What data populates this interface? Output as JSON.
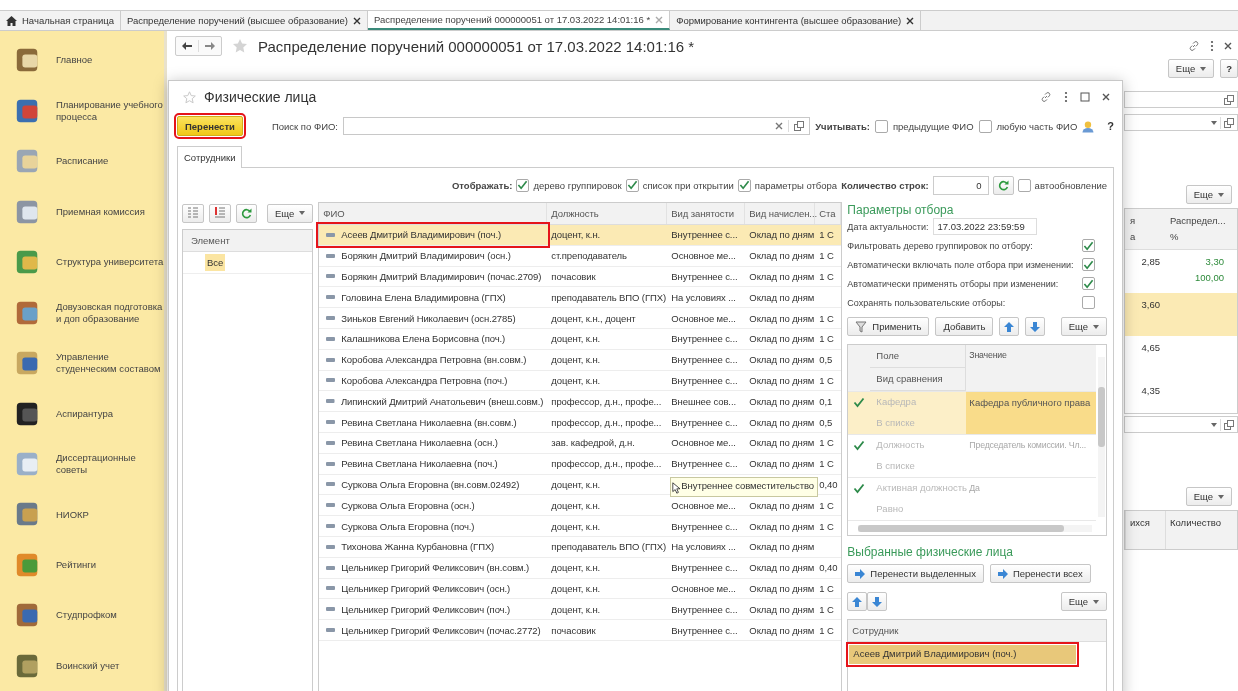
{
  "tabs": [
    {
      "label": "Начальная страница",
      "kind": "home",
      "selected": false,
      "closable": false
    },
    {
      "label": "Распределение поручений (высшее образование)",
      "kind": "document",
      "selected": false,
      "closable": true
    },
    {
      "label": "Распределение поручений 000000051 от 17.03.2022 14:01:16 *",
      "kind": "document",
      "selected": true,
      "closable": true
    },
    {
      "label": "Формирование контингента (высшее образование)",
      "kind": "document",
      "selected": false,
      "closable": true
    }
  ],
  "sidebar": {
    "items": [
      {
        "label": "Главное"
      },
      {
        "label": "Планирование учебного процесса"
      },
      {
        "label": "Расписание"
      },
      {
        "label": "Приемная комиссия"
      },
      {
        "label": "Структура университета"
      },
      {
        "label": "Довузовская подготовка и доп образование"
      },
      {
        "label": "Управление студенческим составом"
      },
      {
        "label": "Аспирантура"
      },
      {
        "label": "Диссертационные советы"
      },
      {
        "label": "НИОКР"
      },
      {
        "label": "Рейтинги"
      },
      {
        "label": "Студпрофком"
      },
      {
        "label": "Воинский учет"
      }
    ]
  },
  "document": {
    "title": "Распределение поручений 000000051 от 17.03.2022 14:01:16 *",
    "more_button": "Еще",
    "help_button": "?",
    "side": {
      "fields": [
        {
          "kind": "text"
        },
        {
          "kind": "dropdown"
        }
      ],
      "more_button": "Еще",
      "table": {
        "columns": [
          [
            "я",
            "а"
          ],
          [
            "Распредел...",
            "%"
          ]
        ],
        "rows": [
          {
            "selected": false,
            "values": [
              [
                "2,85"
              ],
              [
                "3,30",
                "100,00"
              ]
            ]
          },
          {
            "selected": true,
            "values": [
              [
                "3,60"
              ]
            ]
          },
          {
            "selected": false,
            "values": [
              [
                "4,65"
              ]
            ]
          },
          {
            "selected": false,
            "values": [
              [
                "4,35"
              ]
            ]
          }
        ]
      },
      "field": {
        "kind": "dropdown"
      },
      "more_button_2": "Еще",
      "table_2": {
        "columns": [
          "ихся",
          "Количество"
        ]
      }
    }
  },
  "modal": {
    "title": "Физические лица",
    "transfer_button": {
      "label": "Перенести",
      "highlighted": true
    },
    "search": {
      "label": "Поиск по ФИО:"
    },
    "consider": {
      "label": "Учитывать:",
      "options": [
        {
          "label": "предыдущие ФИО",
          "checked": false
        },
        {
          "label": "любую часть ФИО",
          "checked": false
        }
      ]
    },
    "help": "?",
    "tabs": [
      {
        "label": "Сотрудники",
        "selected": true
      }
    ],
    "display": {
      "label": "Отображать:",
      "options": [
        {
          "label": "дерево группировок",
          "checked": true
        },
        {
          "label": "список при открытии",
          "checked": true
        },
        {
          "label": "параметры отбора",
          "checked": true
        }
      ]
    },
    "row_count": {
      "label": "Количество строк:",
      "value": "0"
    },
    "auto_refresh": {
      "label": "автообновление",
      "checked": false
    },
    "tree": {
      "more_button": "Еще",
      "column": "Элемент",
      "items": [
        {
          "label": "Все",
          "selected": true
        }
      ]
    },
    "table": {
      "columns": [
        "ФИО",
        "Должность",
        "Вид занятости",
        "Вид начислен...",
        "Ста"
      ],
      "rows": [
        {
          "fio": "Асеев Дмитрий Владимирович (поч.)",
          "position": "доцент, к.н.",
          "employment": "Внутреннее с...",
          "accrual": "Оклад по дням",
          "rate": "1 С",
          "selected": true,
          "highlighted": true
        },
        {
          "fio": "Борякин Дмитрий Владимирович (осн.)",
          "position": "ст.преподаватель",
          "employment": "Основное ме...",
          "accrual": "Оклад по дням",
          "rate": "1 С",
          "selected": false,
          "highlighted": false
        },
        {
          "fio": "Борякин Дмитрий Владимирович (почас.2709)",
          "position": "почасовик",
          "employment": "Внутреннее с...",
          "accrual": "Оклад по дням",
          "rate": "1 С",
          "selected": false,
          "highlighted": false
        },
        {
          "fio": "Головина Елена Владимировна (ГПХ)",
          "position": "преподаватель ВПО (ГПХ)",
          "employment": "На условиях ...",
          "accrual": "Оклад по дням",
          "selected": false,
          "highlighted": false
        },
        {
          "fio": "Зиньков Евгений Николаевич (осн.2785)",
          "position": "доцент, к.н., доцент",
          "employment": "Основное ме...",
          "accrual": "Оклад по дням",
          "rate": "1 С",
          "selected": false,
          "highlighted": false
        },
        {
          "fio": "Калашникова Елена Борисовна (поч.)",
          "position": "доцент, к.н.",
          "employment": "Внутреннее с...",
          "accrual": "Оклад по дням",
          "rate": "1 С",
          "selected": false,
          "highlighted": false
        },
        {
          "fio": "Коробова Александра Петровна (вн.совм.)",
          "position": "доцент, к.н.",
          "employment": "Внутреннее с...",
          "accrual": "Оклад по дням",
          "rate": "0,5",
          "selected": false,
          "highlighted": false
        },
        {
          "fio": "Коробова Александра Петровна (поч.)",
          "position": "доцент, к.н.",
          "employment": "Внутреннее с...",
          "accrual": "Оклад по дням",
          "rate": "1 С",
          "selected": false,
          "highlighted": false
        },
        {
          "fio": "Липинский Дмитрий Анатольевич (внеш.совм.)",
          "position": "профессор, д.н., профе...",
          "employment": "Внешнее сов...",
          "accrual": "Оклад по дням",
          "rate": "0,1",
          "selected": false,
          "highlighted": false
        },
        {
          "fio": "Ревина Светлана Николаевна (вн.совм.)",
          "position": "профессор, д.н., профе...",
          "employment": "Внутреннее с...",
          "accrual": "Оклад по дням",
          "rate": "0,5",
          "selected": false,
          "highlighted": false
        },
        {
          "fio": "Ревина Светлана Николаевна (осн.)",
          "position": "зав. кафедрой, д.н.",
          "employment": "Основное ме...",
          "accrual": "Оклад по дням",
          "rate": "1 С",
          "selected": false,
          "highlighted": false
        },
        {
          "fio": "Ревина Светлана Николаевна (поч.)",
          "position": "профессор, д.н., профе...",
          "employment": "Внутреннее с...",
          "accrual": "Оклад по дням",
          "rate": "1 С",
          "selected": false,
          "highlighted": false
        },
        {
          "fio": "Суркова Ольга Егоровна (вн.совм.02492)",
          "position": "доцент, к.н.",
          "tooltip": "Внутреннее совместительство",
          "rate": "0,40",
          "selected": false,
          "highlighted": false
        },
        {
          "fio": "Суркова Ольга Егоровна (осн.)",
          "position": "доцент, к.н.",
          "employment": "Основное ме...",
          "accrual": "Оклад по дням",
          "rate": "1 С",
          "selected": false,
          "highlighted": false
        },
        {
          "fio": "Суркова Ольга Егоровна (поч.)",
          "position": "доцент, к.н.",
          "employment": "Внутреннее с...",
          "accrual": "Оклад по дням",
          "rate": "1 С",
          "selected": false,
          "highlighted": false
        },
        {
          "fio": "Тихонова Жанна Курбановна (ГПХ)",
          "position": "преподаватель ВПО (ГПХ)",
          "employment": "На условиях ...",
          "accrual": "Оклад по дням",
          "selected": false,
          "highlighted": false
        },
        {
          "fio": "Цельникер Григорий Феликсович (вн.совм.)",
          "position": "доцент, к.н.",
          "employment": "Внутреннее с...",
          "accrual": "Оклад по дням",
          "rate": "0,40",
          "selected": false,
          "highlighted": false
        },
        {
          "fio": "Цельникер Григорий Феликсович (осн.)",
          "position": "доцент, к.н.",
          "employment": "Основное ме...",
          "accrual": "Оклад по дням",
          "rate": "1 С",
          "selected": false,
          "highlighted": false
        },
        {
          "fio": "Цельникер Григорий Феликсович (поч.)",
          "position": "доцент, к.н.",
          "employment": "Внутреннее с...",
          "accrual": "Оклад по дням",
          "rate": "1 С",
          "selected": false,
          "highlighted": false
        },
        {
          "fio": "Цельникер Григорий Феликсович (почас.2772)",
          "position": "почасовик",
          "employment": "Внутреннее с...",
          "accrual": "Оклад по дням",
          "rate": "1 С",
          "selected": false,
          "highlighted": false
        }
      ]
    },
    "filter": {
      "title": "Параметры отбора",
      "date_label": "Дата актуальности:",
      "date_value": "17.03.2022 23:59:59",
      "settings": [
        {
          "label": "Фильтровать дерево группировок по отбору:",
          "checked": true
        },
        {
          "label": "Автоматически включать поле отбора при изменении:",
          "checked": true
        },
        {
          "label": "Автоматически применять отборы при изменении:",
          "checked": true
        },
        {
          "label": "Сохранять пользовательские отборы:",
          "checked": false
        }
      ],
      "apply_button": "Применить",
      "add_button": "Добавить",
      "more_button": "Еще",
      "columns": [
        "Поле",
        "Вид сравнения",
        "Значение"
      ],
      "rows": [
        {
          "field": "Кафедра",
          "comparison": "В списке",
          "value": "Кафедра публичного права",
          "checked": true,
          "selected": true
        },
        {
          "field": "Должность",
          "comparison": "В списке",
          "value": "Председатель комиссии. Чл...",
          "checked": true,
          "selected": false
        },
        {
          "field": "Активная должность",
          "comparison": "Равно",
          "value": "Да",
          "checked": true,
          "selected": false
        }
      ]
    },
    "chosen": {
      "title": "Выбранные физические лица",
      "transfer_selected": "Перенести выделенных",
      "transfer_all": "Перенести всех",
      "more_button": "Еще",
      "column": "Сотрудник",
      "rows": [
        {
          "label": "Асеев Дмитрий Владимирович (поч.)",
          "selected": true,
          "highlighted": true
        }
      ]
    }
  }
}
